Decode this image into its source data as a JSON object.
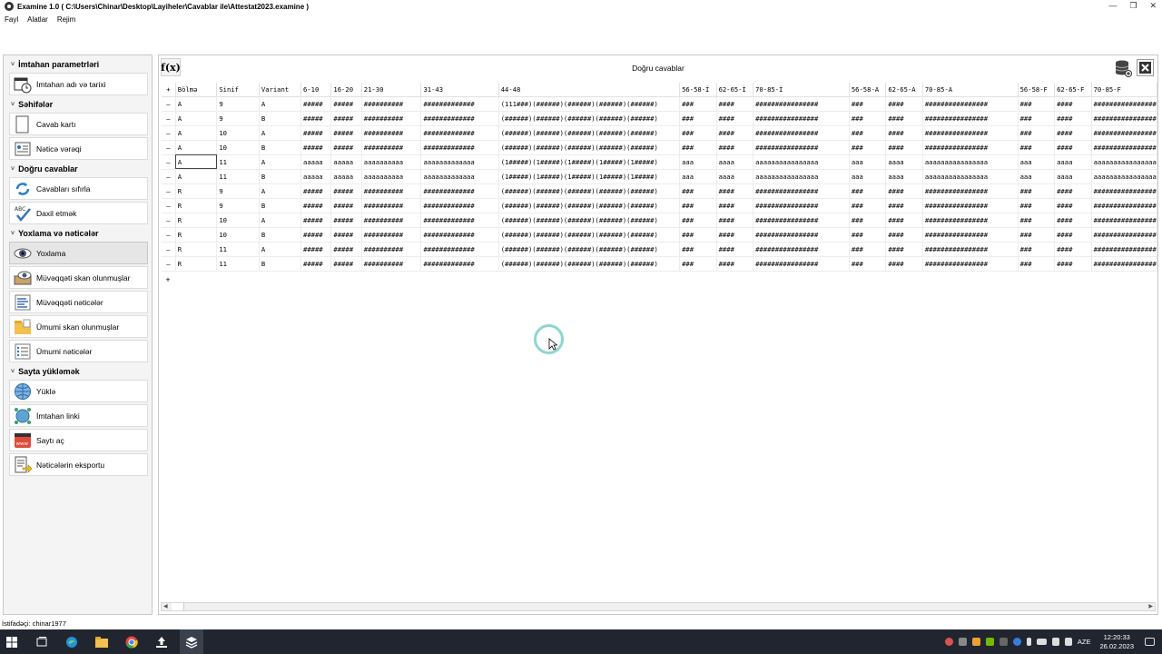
{
  "window": {
    "title": "Examine 1.0 ( C:\\Users\\Chinar\\Desktop\\Layiheler\\Cavablar ile\\Attestat2023.examine )"
  },
  "menu": [
    "Fayl",
    "Alatlar",
    "Rejim"
  ],
  "sidebar": {
    "sections": [
      {
        "title": "İmtahan parametrləri",
        "items": [
          {
            "label": "İmtahan adı və tarixi",
            "icon": "calendar-clock-icon"
          }
        ]
      },
      {
        "title": "Səhifələr",
        "items": [
          {
            "label": "Cavab kartı",
            "icon": "answer-card-icon"
          },
          {
            "label": "Nəticə vərəqi",
            "icon": "result-sheet-icon"
          }
        ]
      },
      {
        "title": "Doğru cavablar",
        "items": [
          {
            "label": "Cavabları sıfırla",
            "icon": "reset-arrows-icon"
          },
          {
            "label": "Daxil etmək",
            "icon": "abc-check-icon"
          }
        ]
      },
      {
        "title": "Yoxlama və nəticələr",
        "items": [
          {
            "label": "Yoxlama",
            "icon": "eye-icon",
            "active": true
          },
          {
            "label": "Müvəqqəti skan olunmuşlar",
            "icon": "scanner-eye-icon"
          },
          {
            "label": "Müvəqqəti nəticələr",
            "icon": "list-lines-icon"
          },
          {
            "label": "Ümumi skan olunmuşlar",
            "icon": "folder-icon"
          },
          {
            "label": "Ümumi nəticələr",
            "icon": "list-bullets-icon"
          }
        ]
      },
      {
        "title": "Sayta yükləmək",
        "items": [
          {
            "label": "Yüklə",
            "icon": "globe-icon"
          },
          {
            "label": "İmtahan linki",
            "icon": "network-globe-icon"
          },
          {
            "label": "Saytı aç",
            "icon": "www-icon"
          },
          {
            "label": "Nəticələrin eksportu",
            "icon": "export-icon"
          }
        ]
      }
    ]
  },
  "main": {
    "fx_label": "f(x)",
    "title": "Doğru cavablar",
    "columns": [
      "Bölmə",
      "Sinif",
      "Variant",
      "6-10",
      "16-20",
      "21-30",
      "31-43",
      "44-48",
      "56-58-İ",
      "62-65-İ",
      "70-85-İ",
      "56-58-A",
      "62-65-A",
      "70-85-A",
      "56-58-F",
      "62-65-F",
      "70-85-F"
    ],
    "rows": [
      [
        "A",
        "9",
        "A",
        "#####",
        "#####",
        "##########",
        "#############",
        "(111###)(######)(######)(######)(######)",
        "###",
        "####",
        "################",
        "###",
        "####",
        "################",
        "###",
        "####",
        "################"
      ],
      [
        "A",
        "9",
        "B",
        "#####",
        "#####",
        "##########",
        "#############",
        "(######)(######)(######)(######)(######)",
        "###",
        "####",
        "################",
        "###",
        "####",
        "################",
        "###",
        "####",
        "################"
      ],
      [
        "A",
        "10",
        "A",
        "#####",
        "#####",
        "##########",
        "#############",
        "(######)(######)(######)(######)(######)",
        "###",
        "####",
        "################",
        "###",
        "####",
        "################",
        "###",
        "####",
        "################"
      ],
      [
        "A",
        "10",
        "B",
        "#####",
        "#####",
        "##########",
        "#############",
        "(######)(######)(######)(######)(######)",
        "###",
        "####",
        "################",
        "###",
        "####",
        "################",
        "###",
        "####",
        "################"
      ],
      [
        "A",
        "11",
        "A",
        "aaaaa",
        "aaaaa",
        "aaaaaaaaaa",
        "aaaaaaaaaaaaa",
        "(1#####)(1#####)(1#####)(1#####)(1#####)",
        "aaa",
        "aaaa",
        "aaaaaaaaaaaaaaaa",
        "aaa",
        "aaaa",
        "aaaaaaaaaaaaaaaa",
        "aaa",
        "aaaa",
        "aaaaaaaaaaaaaaaa"
      ],
      [
        "A",
        "11",
        "B",
        "aaaaa",
        "aaaaa",
        "aaaaaaaaaa",
        "aaaaaaaaaaaaa",
        "(1#####)(1#####)(1#####)(1#####)(1#####)",
        "aaa",
        "aaaa",
        "aaaaaaaaaaaaaaaa",
        "aaa",
        "aaaa",
        "aaaaaaaaaaaaaaaa",
        "aaa",
        "aaaa",
        "aaaaaaaaaaaaaaaa"
      ],
      [
        "R",
        "9",
        "A",
        "#####",
        "#####",
        "##########",
        "#############",
        "(######)(######)(######)(######)(######)",
        "###",
        "####",
        "################",
        "###",
        "####",
        "################",
        "###",
        "####",
        "################"
      ],
      [
        "R",
        "9",
        "B",
        "#####",
        "#####",
        "##########",
        "#############",
        "(######)(######)(######)(######)(######)",
        "###",
        "####",
        "################",
        "###",
        "####",
        "################",
        "###",
        "####",
        "################"
      ],
      [
        "R",
        "10",
        "A",
        "#####",
        "#####",
        "##########",
        "#############",
        "(######)(######)(######)(######)(######)",
        "###",
        "####",
        "################",
        "###",
        "####",
        "################",
        "###",
        "####",
        "################"
      ],
      [
        "R",
        "10",
        "B",
        "#####",
        "#####",
        "##########",
        "#############",
        "(######)(######)(######)(######)(######)",
        "###",
        "####",
        "################",
        "###",
        "####",
        "################",
        "###",
        "####",
        "################"
      ],
      [
        "R",
        "11",
        "A",
        "#####",
        "#####",
        "##########",
        "#############",
        "(######)(######)(######)(######)(######)",
        "###",
        "####",
        "################",
        "###",
        "####",
        "################",
        "###",
        "####",
        "################"
      ],
      [
        "R",
        "11",
        "B",
        "#####",
        "#####",
        "##########",
        "#############",
        "(######)(######)(######)(######)(######)",
        "###",
        "####",
        "################",
        "###",
        "####",
        "################",
        "###",
        "####",
        "################"
      ]
    ],
    "selected_cell": {
      "row": 4,
      "col": 0
    }
  },
  "status": {
    "user": "İstifadəçi: chinar1977"
  },
  "taskbar": {
    "lang": "AZE",
    "time": "12:20:33",
    "date": "26.02.2023",
    "apps": [
      "windows-start-icon",
      "task-view-icon",
      "edge-icon",
      "file-explorer-icon",
      "chrome-icon",
      "app-upload-icon",
      "examine-app-icon"
    ]
  },
  "colors": {
    "accent_spinner": "#8fd6cc",
    "taskbar": "#202530"
  }
}
